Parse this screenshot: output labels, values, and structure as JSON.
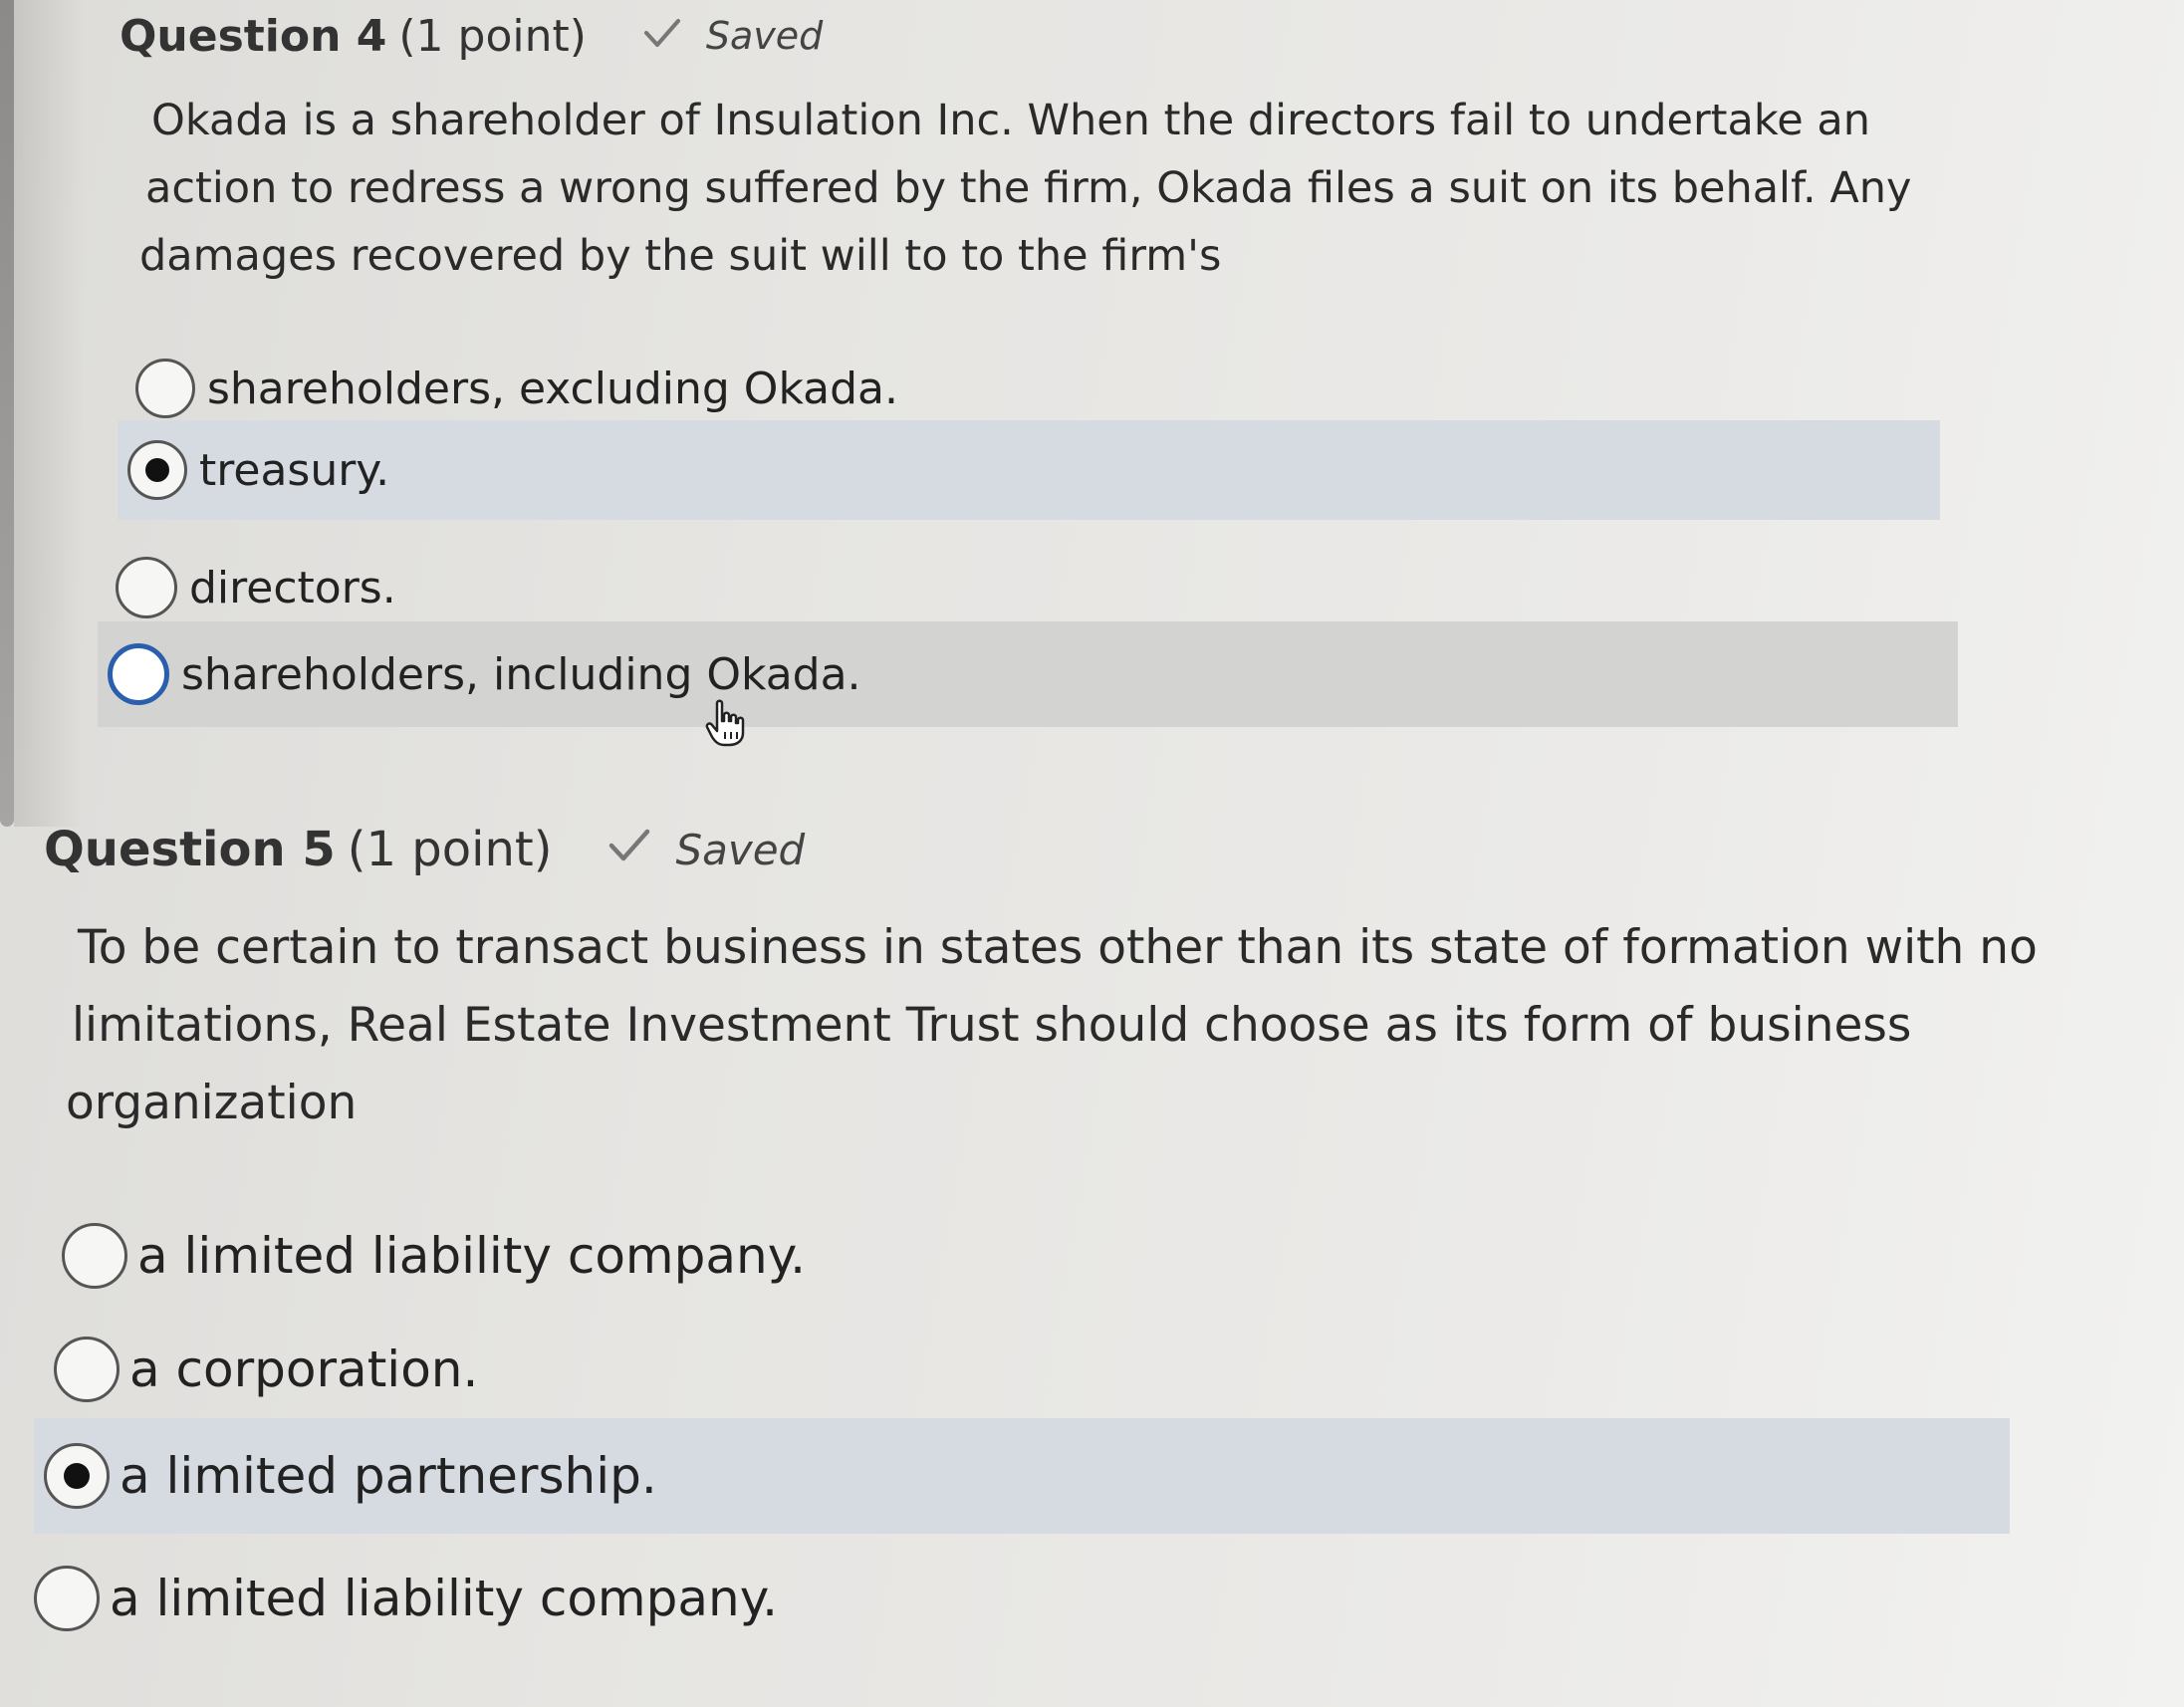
{
  "q4": {
    "title": "Question 4",
    "points": "(1 point)",
    "saved": "Saved",
    "text_lines": [
      "Okada is a shareholder of Insulation Inc.  When the directors fail to undertake an",
      "action to redress a wrong suffered by the firm, Okada files a suit on its behalf.  Any",
      "damages recovered by the suit will to to the firm's"
    ],
    "options": [
      {
        "label": "shareholders, excluding Okada.",
        "selected": false
      },
      {
        "label": "treasury.",
        "selected": true
      },
      {
        "label": "directors.",
        "selected": false
      },
      {
        "label": "shareholders, including Okada.",
        "selected": false
      }
    ]
  },
  "q5": {
    "title": "Question 5",
    "points": "(1 point)",
    "saved": "Saved",
    "text_lines": [
      "To be certain to transact business in states other than its state of formation with no",
      "limitations, Real Estate Investment Trust should choose as its form of business",
      "organization"
    ],
    "options": [
      {
        "label": "a limited liability company.",
        "selected": false
      },
      {
        "label": "a corporation.",
        "selected": false
      },
      {
        "label": "a limited partnership.",
        "selected": true
      },
      {
        "label": "a limited liability company.",
        "selected": false
      }
    ]
  },
  "icons": {
    "check": "checkmark-icon",
    "radio_selected": "radio-selected-icon",
    "radio_empty": "radio-empty-icon",
    "cursor": "hand-pointer-icon"
  },
  "colors": {
    "selected_row": "#d5dbe1",
    "hovered_row": "#d3d3d2",
    "focus_ring": "#2a5fae"
  }
}
